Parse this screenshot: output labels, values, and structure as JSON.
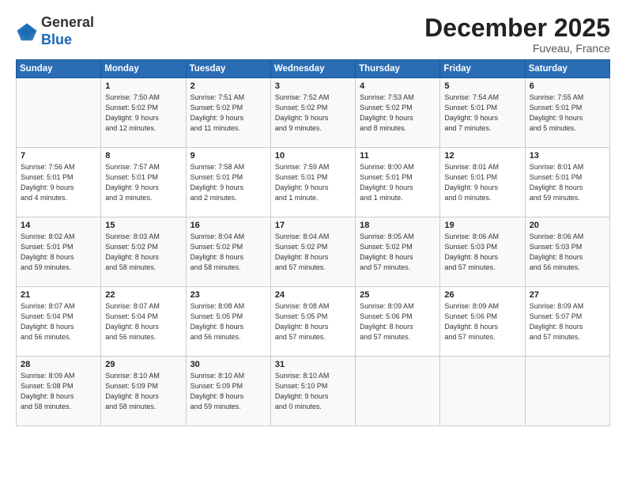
{
  "header": {
    "logo": {
      "line1": "General",
      "line2": "Blue"
    },
    "title": "December 2025",
    "location": "Fuveau, France"
  },
  "days_of_week": [
    "Sunday",
    "Monday",
    "Tuesday",
    "Wednesday",
    "Thursday",
    "Friday",
    "Saturday"
  ],
  "weeks": [
    [
      {
        "day": "",
        "info": ""
      },
      {
        "day": "1",
        "info": "Sunrise: 7:50 AM\nSunset: 5:02 PM\nDaylight: 9 hours\nand 12 minutes."
      },
      {
        "day": "2",
        "info": "Sunrise: 7:51 AM\nSunset: 5:02 PM\nDaylight: 9 hours\nand 11 minutes."
      },
      {
        "day": "3",
        "info": "Sunrise: 7:52 AM\nSunset: 5:02 PM\nDaylight: 9 hours\nand 9 minutes."
      },
      {
        "day": "4",
        "info": "Sunrise: 7:53 AM\nSunset: 5:02 PM\nDaylight: 9 hours\nand 8 minutes."
      },
      {
        "day": "5",
        "info": "Sunrise: 7:54 AM\nSunset: 5:01 PM\nDaylight: 9 hours\nand 7 minutes."
      },
      {
        "day": "6",
        "info": "Sunrise: 7:55 AM\nSunset: 5:01 PM\nDaylight: 9 hours\nand 5 minutes."
      }
    ],
    [
      {
        "day": "7",
        "info": "Sunrise: 7:56 AM\nSunset: 5:01 PM\nDaylight: 9 hours\nand 4 minutes."
      },
      {
        "day": "8",
        "info": "Sunrise: 7:57 AM\nSunset: 5:01 PM\nDaylight: 9 hours\nand 3 minutes."
      },
      {
        "day": "9",
        "info": "Sunrise: 7:58 AM\nSunset: 5:01 PM\nDaylight: 9 hours\nand 2 minutes."
      },
      {
        "day": "10",
        "info": "Sunrise: 7:59 AM\nSunset: 5:01 PM\nDaylight: 9 hours\nand 1 minute."
      },
      {
        "day": "11",
        "info": "Sunrise: 8:00 AM\nSunset: 5:01 PM\nDaylight: 9 hours\nand 1 minute."
      },
      {
        "day": "12",
        "info": "Sunrise: 8:01 AM\nSunset: 5:01 PM\nDaylight: 9 hours\nand 0 minutes."
      },
      {
        "day": "13",
        "info": "Sunrise: 8:01 AM\nSunset: 5:01 PM\nDaylight: 8 hours\nand 59 minutes."
      }
    ],
    [
      {
        "day": "14",
        "info": "Sunrise: 8:02 AM\nSunset: 5:01 PM\nDaylight: 8 hours\nand 59 minutes."
      },
      {
        "day": "15",
        "info": "Sunrise: 8:03 AM\nSunset: 5:02 PM\nDaylight: 8 hours\nand 58 minutes."
      },
      {
        "day": "16",
        "info": "Sunrise: 8:04 AM\nSunset: 5:02 PM\nDaylight: 8 hours\nand 58 minutes."
      },
      {
        "day": "17",
        "info": "Sunrise: 8:04 AM\nSunset: 5:02 PM\nDaylight: 8 hours\nand 57 minutes."
      },
      {
        "day": "18",
        "info": "Sunrise: 8:05 AM\nSunset: 5:02 PM\nDaylight: 8 hours\nand 57 minutes."
      },
      {
        "day": "19",
        "info": "Sunrise: 8:06 AM\nSunset: 5:03 PM\nDaylight: 8 hours\nand 57 minutes."
      },
      {
        "day": "20",
        "info": "Sunrise: 8:06 AM\nSunset: 5:03 PM\nDaylight: 8 hours\nand 56 minutes."
      }
    ],
    [
      {
        "day": "21",
        "info": "Sunrise: 8:07 AM\nSunset: 5:04 PM\nDaylight: 8 hours\nand 56 minutes."
      },
      {
        "day": "22",
        "info": "Sunrise: 8:07 AM\nSunset: 5:04 PM\nDaylight: 8 hours\nand 56 minutes."
      },
      {
        "day": "23",
        "info": "Sunrise: 8:08 AM\nSunset: 5:05 PM\nDaylight: 8 hours\nand 56 minutes."
      },
      {
        "day": "24",
        "info": "Sunrise: 8:08 AM\nSunset: 5:05 PM\nDaylight: 8 hours\nand 57 minutes."
      },
      {
        "day": "25",
        "info": "Sunrise: 8:09 AM\nSunset: 5:06 PM\nDaylight: 8 hours\nand 57 minutes."
      },
      {
        "day": "26",
        "info": "Sunrise: 8:09 AM\nSunset: 5:06 PM\nDaylight: 8 hours\nand 57 minutes."
      },
      {
        "day": "27",
        "info": "Sunrise: 8:09 AM\nSunset: 5:07 PM\nDaylight: 8 hours\nand 57 minutes."
      }
    ],
    [
      {
        "day": "28",
        "info": "Sunrise: 8:09 AM\nSunset: 5:08 PM\nDaylight: 8 hours\nand 58 minutes."
      },
      {
        "day": "29",
        "info": "Sunrise: 8:10 AM\nSunset: 5:09 PM\nDaylight: 8 hours\nand 58 minutes."
      },
      {
        "day": "30",
        "info": "Sunrise: 8:10 AM\nSunset: 5:09 PM\nDaylight: 8 hours\nand 59 minutes."
      },
      {
        "day": "31",
        "info": "Sunrise: 8:10 AM\nSunset: 5:10 PM\nDaylight: 9 hours\nand 0 minutes."
      },
      {
        "day": "",
        "info": ""
      },
      {
        "day": "",
        "info": ""
      },
      {
        "day": "",
        "info": ""
      }
    ]
  ]
}
